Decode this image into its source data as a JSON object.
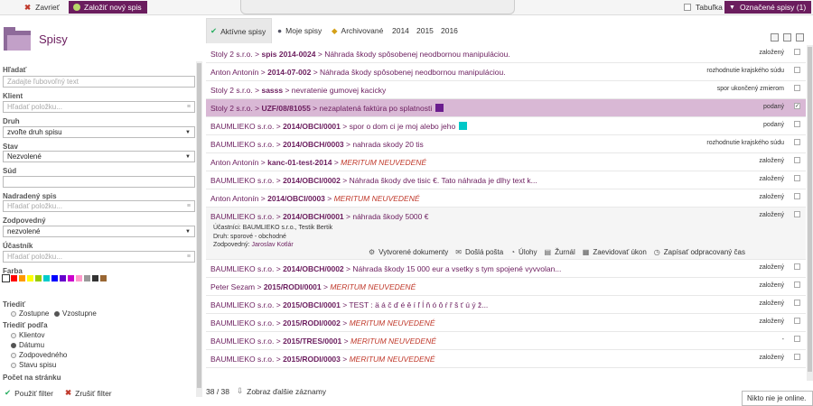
{
  "topbar": {
    "close_label": "Zavrieť",
    "new_label": "Založiť nový spis",
    "table_label": "Tabuľka",
    "marked_label": "Označené spisy (1)"
  },
  "sidebar": {
    "title": "Spisy",
    "search_label": "Hľadať",
    "search_placeholder": "Zadajte ľubovoľný text",
    "client_label": "Klient",
    "client_placeholder": "Hľadať položku...",
    "type_label": "Druh",
    "type_value": "zvoľte druh spisu",
    "state_label": "Stav",
    "state_value": "Nezvolené",
    "court_label": "Súd",
    "parent_label": "Nadradený spis",
    "parent_placeholder": "Hľadať položku...",
    "responsible_label": "Zodpovedný",
    "responsible_value": "nezvolené",
    "participant_label": "Účastník",
    "participant_placeholder": "Hľadať položku...",
    "color_label": "Farba",
    "colors": [
      "#ffffff",
      "#ff0000",
      "#ff9900",
      "#ffff00",
      "#99cc00",
      "#00cccc",
      "#0000ff",
      "#6600cc",
      "#cc00cc",
      "#ff99cc",
      "#999999",
      "#333333",
      "#996633"
    ],
    "sort_label": "Triediť",
    "sort_desc": "Zostupne",
    "sort_asc": "Vzostupne",
    "sortby_label": "Triediť podľa",
    "sortby": [
      "Klientov",
      "Dátumu",
      "Zodpovedného",
      "Stavu spisu"
    ],
    "perpage_label": "Počet na stránku",
    "apply_label": "Použiť filter",
    "cancel_label": "Zrušiť filter"
  },
  "tabs": {
    "active": "Aktívne spisy",
    "mine": "Moje spisy",
    "archived": "Archivované",
    "y2014": "2014",
    "y2015": "2015",
    "y2016": "2016"
  },
  "rows": [
    {
      "client": "Stoly 2 s.r.o.",
      "code": "spis 2014-0024",
      "desc": "Náhrada škody spôsobenej neodbornou manipuláciou.",
      "status": "založený",
      "warn": false
    },
    {
      "client": "Anton Antonín",
      "code": "2014-07-002",
      "desc": "Náhrada škody spôsobenej neodbornou manipuláciou.",
      "status": "rozhodnutie krajského súdu",
      "warn": false
    },
    {
      "client": "Stoly 2 s.r.o.",
      "code": "sasss",
      "desc": "nevratenie gumovej kacicky",
      "status": "spor ukončený zmierom",
      "warn": false
    },
    {
      "client": "Stoly 2 s.r.o.",
      "code": "UZF/08/81055",
      "desc": "nezaplatená faktúra po splatnosti",
      "status": "podaný",
      "warn": false,
      "color": "#6b1d8e"
    },
    {
      "client": "BAUMLIEKO s.r.o.",
      "code": "2014/OBCI/0001",
      "desc": "spor o dom ci je moj alebo jeho",
      "status": "podaný",
      "warn": false,
      "color": "#00c8c8"
    },
    {
      "client": "BAUMLIEKO s.r.o.",
      "code": "2014/OBCH/0003",
      "desc": "nahrada skody 20 tis",
      "status": "rozhodnutie krajského súdu",
      "warn": false
    },
    {
      "client": "Anton Antonín",
      "code": "kanc-01-test-2014",
      "desc": "MERITUM NEUVEDENÉ",
      "status": "založený",
      "warn": true
    },
    {
      "client": "BAUMLIEKO s.r.o.",
      "code": "2014/OBCI/0002",
      "desc": "Náhrada škody dve tisic €. Tato náhrada je dlhy text k...",
      "status": "založený",
      "warn": false
    },
    {
      "client": "Anton Antonín",
      "code": "2014/OBCI/0003",
      "desc": "MERITUM NEUVEDENÉ",
      "status": "založený",
      "warn": true
    },
    {
      "client": "BAUMLIEKO s.r.o.",
      "code": "2014/OBCH/0001",
      "desc": "náhrada škody 5000 €",
      "status": "založený",
      "warn": false
    },
    {
      "client": "BAUMLIEKO s.r.o.",
      "code": "2014/OBCH/0002",
      "desc": "Náhrada škody 15 000 eur a vsetky s tym spojené vyvvolan...",
      "status": "založený",
      "warn": false
    },
    {
      "client": "Peter Sezam",
      "code": "2015/RODI/0001",
      "desc": "MERITUM NEUVEDENÉ",
      "status": "založený",
      "warn": true
    },
    {
      "client": "BAUMLIEKO s.r.o.",
      "code": "2015/OBCI/0001",
      "desc": "TEST : ä á č ď é ě í ľ ĺ ň ó ô ŕ ř š ť ú ý ž...",
      "status": "založený",
      "warn": false
    },
    {
      "client": "BAUMLIEKO s.r.o.",
      "code": "2015/RODI/0002",
      "desc": "MERITUM NEUVEDENÉ",
      "status": "založený",
      "warn": true
    },
    {
      "client": "BAUMLIEKO s.r.o.",
      "code": "2015/TRES/0001",
      "desc": "MERITUM NEUVEDENÉ",
      "status": "-",
      "warn": true
    },
    {
      "client": "BAUMLIEKO s.r.o.",
      "code": "2015/RODI/0003",
      "desc": "MERITUM NEUVEDENÉ",
      "status": "založený",
      "warn": true
    }
  ],
  "expanded": {
    "participants": "Účastníci: BAUMLIEKO s.r.o., Testik Bertik",
    "type": "Druh: sporové - obchodné",
    "responsible_label": "Zodpovedný:",
    "responsible": "Jaroslav Kotlár",
    "actions": [
      "Vytvorené dokumenty",
      "Došlá pošta",
      "Úlohy",
      "Žurnál",
      "Zaevidovať úkon",
      "Zapísať odpracovaný čas"
    ]
  },
  "footer": {
    "count": "38 / 38",
    "more_label": "Zobraz ďalšie záznamy"
  },
  "online": "Nikto nie je online."
}
